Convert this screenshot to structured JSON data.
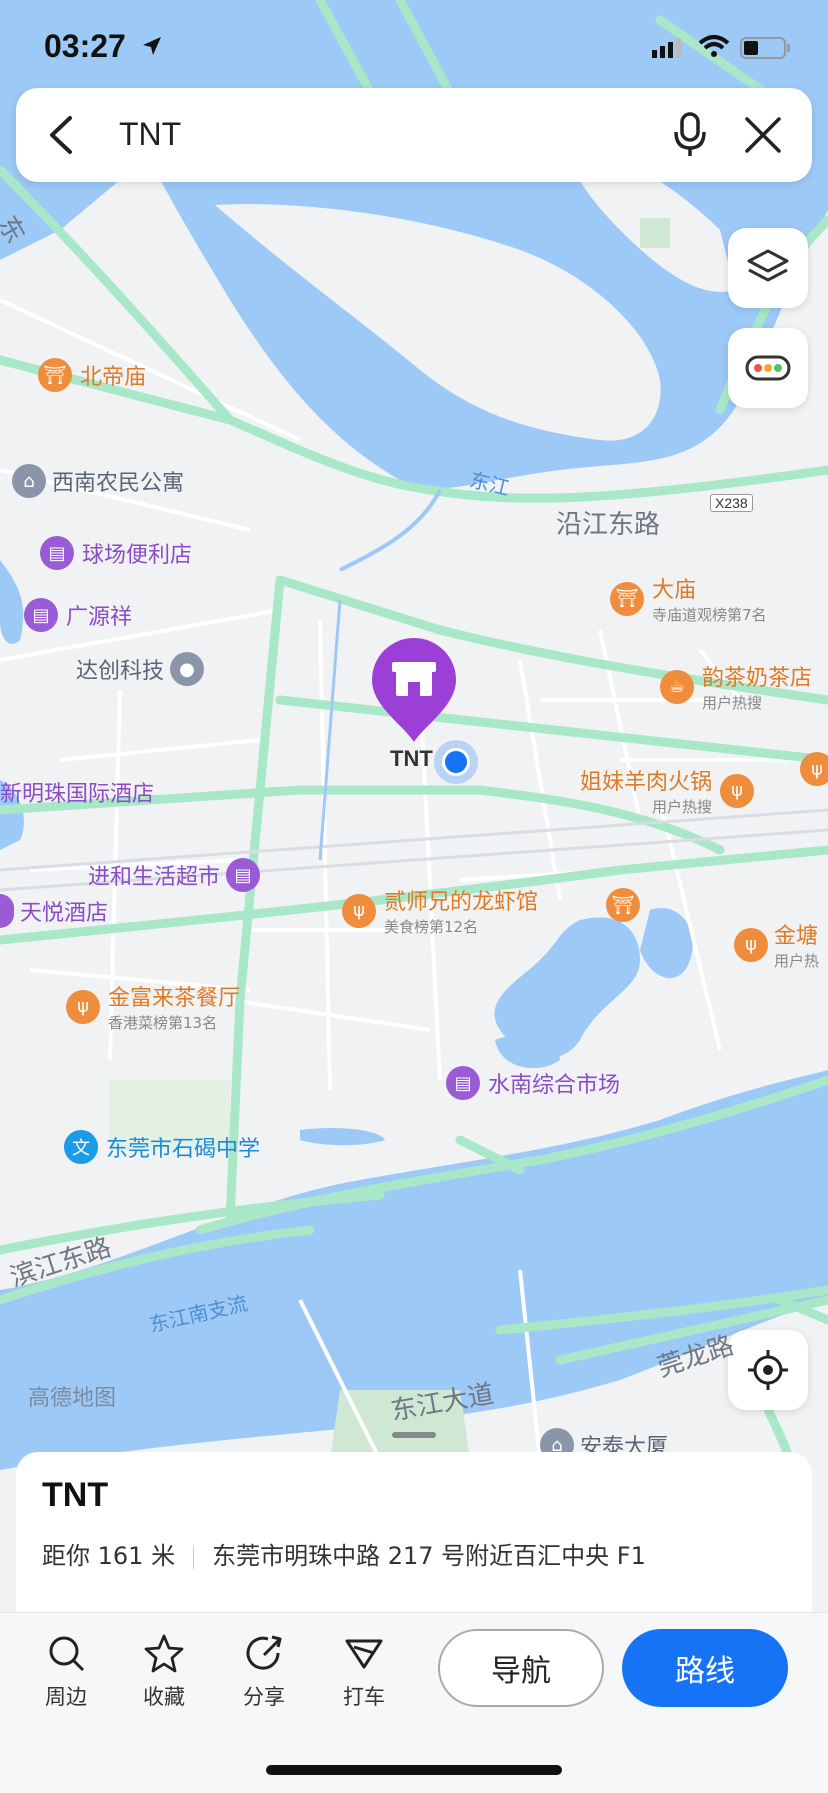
{
  "status": {
    "time": "03:27"
  },
  "search": {
    "query": "TNT"
  },
  "map": {
    "water_labels": {
      "dongjiang": "东江",
      "nanzhiliu": "东江南支流"
    },
    "road_labels": {
      "yanjiang": "沿江东路",
      "binjiang": "滨江东路",
      "dongjiang_dadao": "东江大道",
      "guanlong": "莞龙路",
      "x238": "X238",
      "top_left_fragment": "东"
    },
    "selected_marker": {
      "label": "TNT"
    },
    "pois": [
      {
        "name": "北帝庙",
        "sub": ""
      },
      {
        "name": "西南农民公寓",
        "sub": ""
      },
      {
        "name": "球场便利店",
        "sub": ""
      },
      {
        "name": "广源祥",
        "sub": ""
      },
      {
        "name": "达创科技",
        "sub": ""
      },
      {
        "name": "新明珠国际酒店",
        "sub": ""
      },
      {
        "name": "进和生活超市",
        "sub": ""
      },
      {
        "name": "天悦酒店",
        "sub": ""
      },
      {
        "name": "金富来茶餐厅",
        "sub": "香港菜榜第13名"
      },
      {
        "name": "东莞市石碣中学",
        "sub": ""
      },
      {
        "name": "大庙",
        "sub": "寺庙道观榜第7名"
      },
      {
        "name": "韵茶奶茶店",
        "sub": "用户热搜"
      },
      {
        "name": "姐妹羊肉火锅",
        "sub": "用户热搜"
      },
      {
        "name": "贰师兄的龙虾馆",
        "sub": "美食榜第12名"
      },
      {
        "name": "金塘",
        "sub": "用户热"
      },
      {
        "name": "水南综合市场",
        "sub": ""
      },
      {
        "name": "安泰大厦",
        "sub": ""
      }
    ],
    "watermark": "高德地图"
  },
  "sheet": {
    "title": "TNT",
    "distance": "距你 161 米",
    "address": "东莞市明珠中路 217 号附近百汇中央 F1"
  },
  "toolbar": {
    "nearby": "周边",
    "favorite": "收藏",
    "share": "分享",
    "taxi": "打车",
    "navigate": "导航",
    "route": "路线"
  },
  "colors": {
    "accent": "#1673f6",
    "water": "#9dc9f7",
    "road": "#a8e8c8",
    "marker": "#9c3fd6"
  }
}
